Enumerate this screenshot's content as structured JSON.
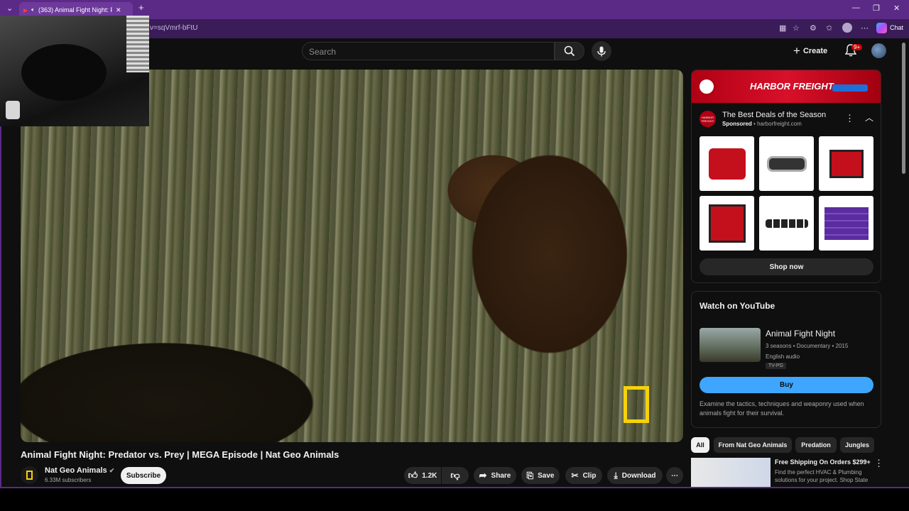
{
  "browser": {
    "tab_title": "(363) Animal Fight Night: Pred",
    "url_fragment": "v=sqVmrf-bFtU",
    "chat_label": "Chat"
  },
  "header": {
    "search_placeholder": "Search",
    "create_label": "Create",
    "notification_badge": "9+"
  },
  "video": {
    "title": "Animal Fight Night: Predator vs. Prey | MEGA Episode | Nat Geo Animals",
    "channel_name": "Nat Geo Animals",
    "subscribers": "6.33M subscribers",
    "subscribe_label": "Subscribe",
    "likes": "1.2K",
    "share_label": "Share",
    "save_label": "Save",
    "clip_label": "Clip",
    "download_label": "Download"
  },
  "ad": {
    "banner_text": "HARBOR FREIGHT",
    "logo_text": "HARBOR FREIGHT",
    "title": "The Best Deals of the Season",
    "sponsored": "Sponsored",
    "domain": "harborfreight.com",
    "shop_now_label": "Shop now",
    "products": [
      "generator-red",
      "winch",
      "water-pump",
      "inverter-generator",
      "socket-set",
      "tool-chest-purple"
    ]
  },
  "watch_card": {
    "heading": "Watch on YouTube",
    "show_title": "Animal Fight Night",
    "meta": "3 seasons • Documentary • 2015",
    "audio": "English audio",
    "rating": "TV-PG",
    "buy_label": "Buy",
    "description": "Examine the tactics, techniques and weaponry used when animals fight for their survival."
  },
  "chips": [
    "All",
    "From Nat Geo Animals",
    "Predation",
    "Jungles"
  ],
  "bottom_ad": {
    "title": "Free Shipping On Orders $299+",
    "description": "Find the perfect HVAC & Plumbing solutions for your project. Shop State"
  },
  "colors": {
    "tabstrip": "#5b2a86",
    "accent_blue": "#3ea6ff",
    "brand_red": "#d8102a",
    "natgeo_yellow": "#f5d20a"
  }
}
